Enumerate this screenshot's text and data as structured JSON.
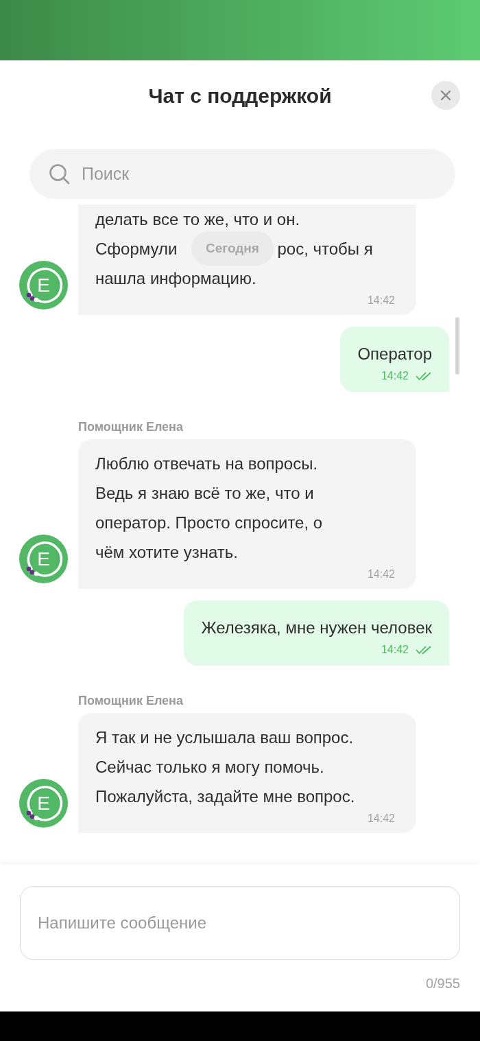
{
  "header": {
    "title": "Чат с поддержкой"
  },
  "search": {
    "placeholder": "Поиск"
  },
  "date_chip": "Сегодня",
  "messages": [
    {
      "kind": "bot",
      "avatar": "Е",
      "lines": [
        "делать все то же, что и он.",
        [
          "Сформули",
          "рос, чтобы я"
        ],
        "нашла информацию."
      ],
      "time": "14:42"
    },
    {
      "kind": "user",
      "text": "Оператор",
      "time": "14:42",
      "read": true
    },
    {
      "kind": "bot",
      "sender": "Помощник Елена",
      "avatar": "Е",
      "lines": [
        "Люблю отвечать на вопросы.",
        "Ведь я знаю всё то же, что и",
        "оператор. Просто спросите, о",
        "чём хотите узнать."
      ],
      "time": "14:42"
    },
    {
      "kind": "user",
      "text": "Железяка, мне нужен человек",
      "time": "14:42",
      "read": true
    },
    {
      "kind": "bot",
      "sender": "Помощник Елена",
      "avatar": "Е",
      "lines": [
        "Я так и не услышала ваш вопрос.",
        "Сейчас только я могу помочь.",
        "Пожалуйста, задайте мне вопрос."
      ],
      "time": "14:42"
    }
  ],
  "composer": {
    "placeholder": "Напишите сообщение",
    "counter": "0/955"
  }
}
